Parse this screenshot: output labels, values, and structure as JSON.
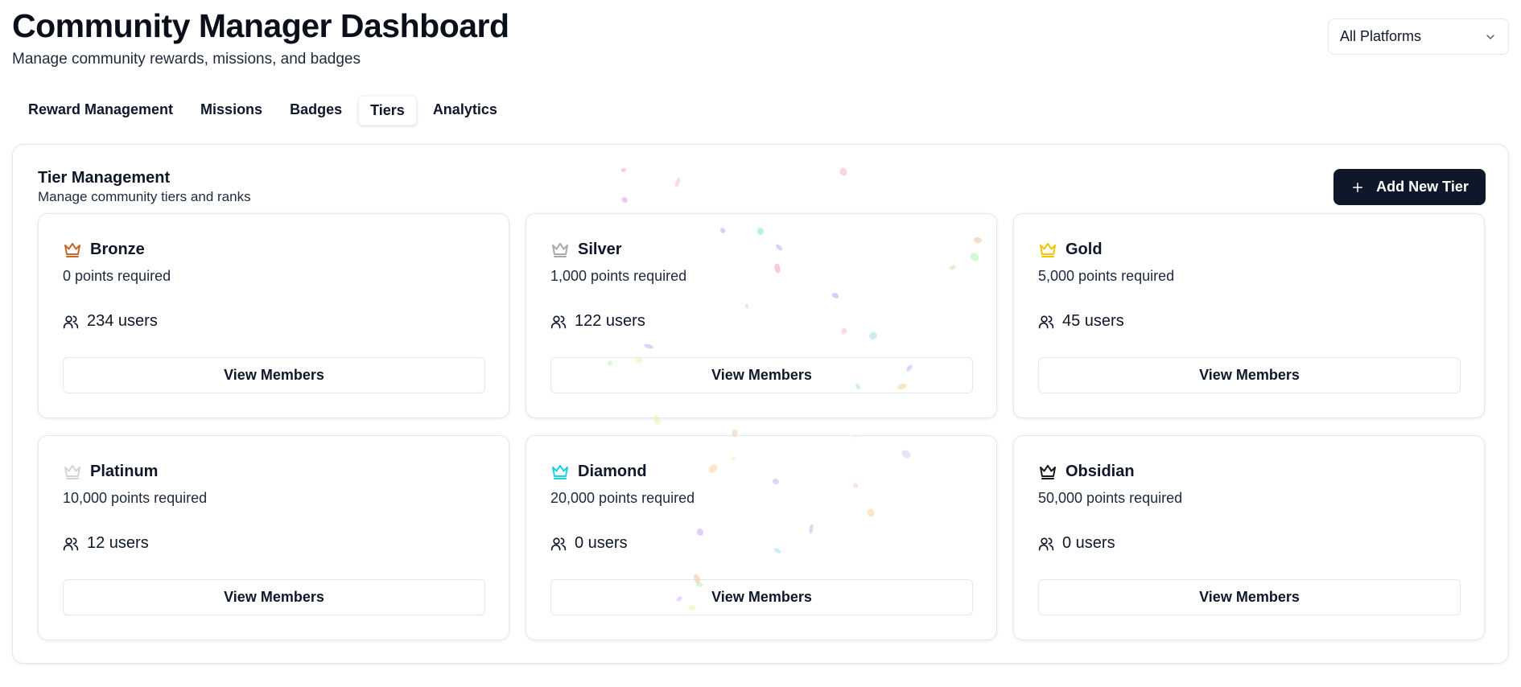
{
  "header": {
    "title": "Community Manager Dashboard",
    "subtitle": "Manage community rewards, missions, and badges"
  },
  "platform_select": {
    "value": "All Platforms",
    "icon": "chevron-down-icon"
  },
  "tabs": [
    {
      "label": "Reward Management",
      "active": false
    },
    {
      "label": "Missions",
      "active": false
    },
    {
      "label": "Badges",
      "active": false
    },
    {
      "label": "Tiers",
      "active": true
    },
    {
      "label": "Analytics",
      "active": false
    }
  ],
  "panel": {
    "title": "Tier Management",
    "description": "Manage community tiers and ranks",
    "add_button_label": "Add New Tier",
    "add_button_icon": "plus-icon"
  },
  "tiers": [
    {
      "name": "Bronze",
      "points": "0 points required",
      "users": "234 users",
      "button": "View Members",
      "crown_color": "#c2692b"
    },
    {
      "name": "Silver",
      "points": "1,000 points required",
      "users": "122 users",
      "button": "View Members",
      "crown_color": "#a8a8a8"
    },
    {
      "name": "Gold",
      "points": "5,000 points required",
      "users": "45 users",
      "button": "View Members",
      "crown_color": "#f5c400"
    },
    {
      "name": "Platinum",
      "points": "10,000 points required",
      "users": "12 users",
      "button": "View Members",
      "crown_color": "#d4d4d4"
    },
    {
      "name": "Diamond",
      "points": "20,000 points required",
      "users": "0 users",
      "button": "View Members",
      "crown_color": "#16d0e6"
    },
    {
      "name": "Obsidian",
      "points": "50,000 points required",
      "users": "0 users",
      "button": "View Members",
      "crown_color": "#1a1a1a"
    }
  ],
  "colors": {
    "primary": "#0f172a",
    "border": "#e2e8f0",
    "background": "#ffffff"
  }
}
